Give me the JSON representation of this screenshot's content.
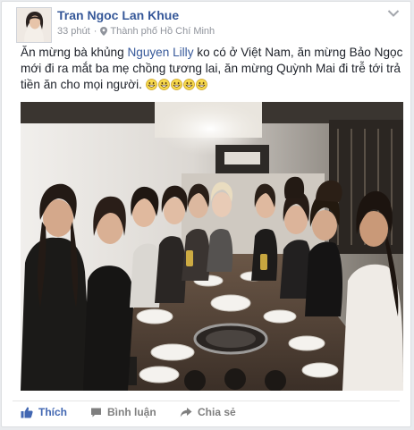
{
  "post": {
    "author": "Tran Ngoc Lan Khue",
    "time": "33 phút",
    "separator": "·",
    "location": "Thành phố Hồ Chí Minh",
    "text_before_mention": "Ăn mừng bà khủng ",
    "mention": "Nguyen Lilly",
    "text_after_mention": " ko có ở Việt Nam, ăn mừng Bảo Ngọc mới đi ra mắt ba mẹ chồng tương lai, ăn mừng Quỳnh Mai đi trễ tới trả tiền ăn cho mọi người.",
    "emoji_count": 5,
    "emoji_icon": "grinning-face-emoji",
    "photo_icon": "group-photo"
  },
  "actions": {
    "like_label": "Thích",
    "comment_label": "Bình luận",
    "share_label": "Chia sẻ"
  },
  "colors": {
    "link": "#365899",
    "like": "#4267b2",
    "muted": "#90949c",
    "text": "#1d2129",
    "background": "#e9ebee"
  }
}
